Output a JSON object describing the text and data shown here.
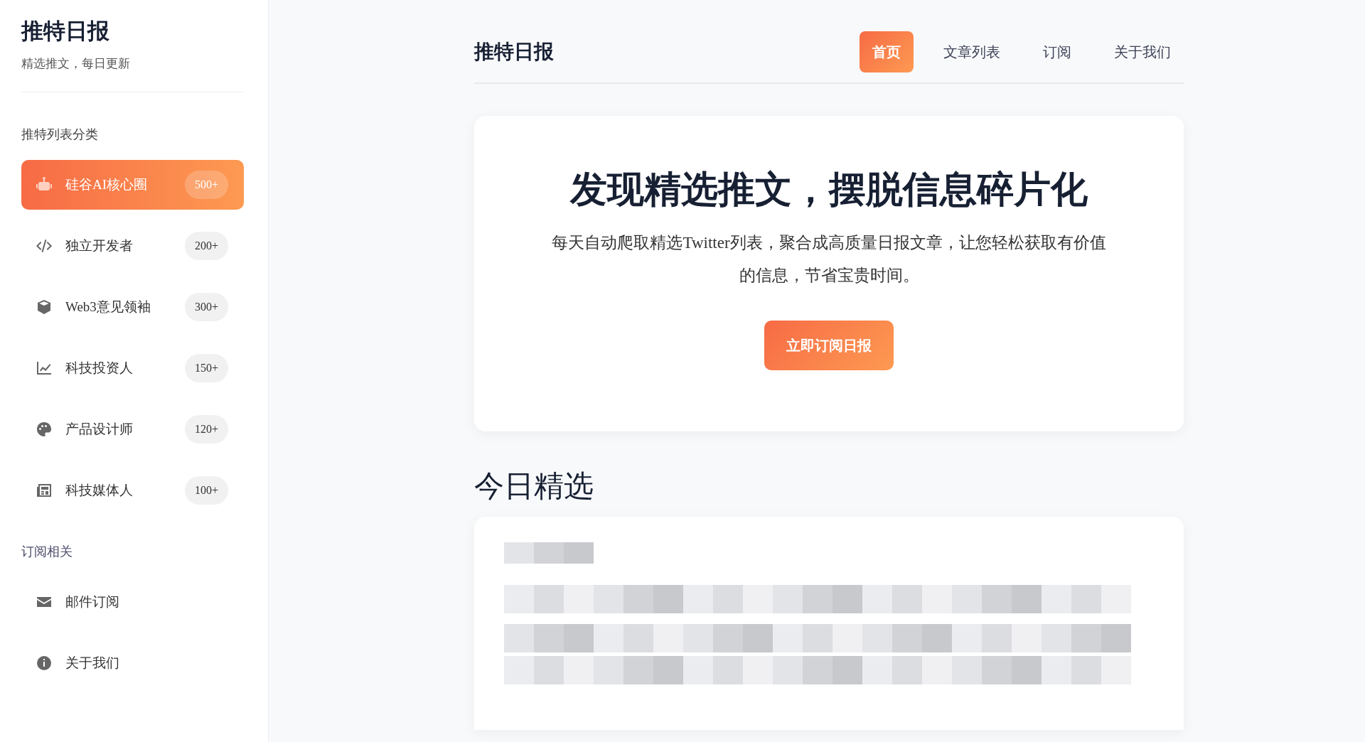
{
  "sidebar": {
    "title": "推特日报",
    "subtitle": "精选推文，每日更新",
    "sections": [
      {
        "heading": "推特列表分类",
        "items": [
          {
            "kind": "robot",
            "label": "硅谷AI核心圈",
            "count": "500+",
            "selected": true
          },
          {
            "kind": "code",
            "label": "独立开发者",
            "count": "200+",
            "selected": false
          },
          {
            "kind": "cube",
            "label": "Web3意见领袖",
            "count": "300+",
            "selected": false
          },
          {
            "kind": "chart",
            "label": "科技投资人",
            "count": "150+",
            "selected": false
          },
          {
            "kind": "palette",
            "label": "产品设计师",
            "count": "120+",
            "selected": false
          },
          {
            "kind": "newspaper",
            "label": "科技媒体人",
            "count": "100+",
            "selected": false
          }
        ]
      },
      {
        "heading": "订阅相关",
        "items": [
          {
            "kind": "envelope",
            "label": "邮件订阅",
            "selected": false
          },
          {
            "kind": "info",
            "label": "关于我们",
            "selected": false
          }
        ]
      }
    ]
  },
  "header": {
    "brand": "推特日报",
    "nav": [
      {
        "label": "首页",
        "selected": true
      },
      {
        "label": "文章列表",
        "selected": false
      },
      {
        "label": "订阅",
        "selected": false
      },
      {
        "label": "关于我们",
        "selected": false
      }
    ]
  },
  "hero": {
    "title": "发现精选推文，摆脱信息碎片化",
    "text": "每天自动爬取精选Twitter列表，聚合成高质量日报文章，让您轻松获取有价值的信息，节省宝贵时间。",
    "button": "立即订阅日报"
  },
  "featured": {
    "heading": "今日精选",
    "article": {
      "redacted": true
    }
  }
}
